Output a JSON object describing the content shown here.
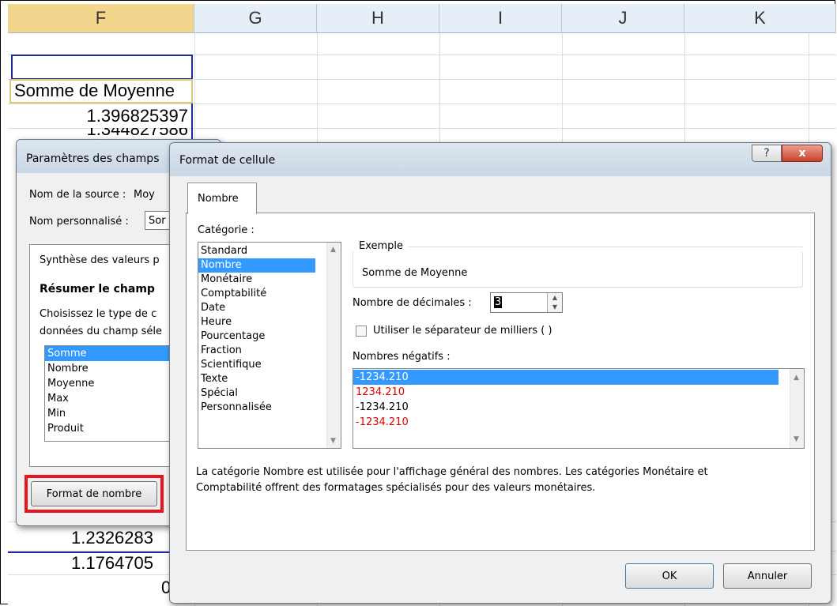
{
  "sheet": {
    "columns": [
      "F",
      "G",
      "H",
      "I",
      "J",
      "K"
    ],
    "cells": [
      "Somme de Moyenne",
      "1.396825397",
      "1.344827586",
      "1.2326283",
      "1.1764705",
      "0"
    ]
  },
  "field_dialog": {
    "title": "Paramètres des champs",
    "source_label": "Nom de la source :",
    "source_value": "Moy",
    "custom_label": "Nom personnalisé :",
    "custom_value": "Sor",
    "tab_label": "Synthèse des valeurs p",
    "section_title": "Résumer le champ",
    "desc_line1": "Choisissez le type de c",
    "desc_line2": "données du champ séle",
    "functions": [
      "Somme",
      "Nombre",
      "Moyenne",
      "Max",
      "Min",
      "Produit"
    ],
    "number_format_button": "Format de nombre"
  },
  "format_dialog": {
    "title": "Format de cellule",
    "help_icon": "question-icon",
    "close_icon": "close-icon",
    "tab": "Nombre",
    "category_label": "Catégorie :",
    "categories": [
      "Standard",
      "Nombre",
      "Monétaire",
      "Comptabilité",
      "Date",
      "Heure",
      "Pourcentage",
      "Fraction",
      "Scientifique",
      "Texte",
      "Spécial",
      "Personnalisée"
    ],
    "example_label": "Exemple",
    "example_value": "Somme de Moyenne",
    "decimals_label": "Nombre de décimales :",
    "decimals_value": "3",
    "thousands_label": "Utiliser le séparateur de milliers ( )",
    "negatives_label": "Nombres négatifs :",
    "negatives": [
      "-1234.210",
      "1234.210",
      "-1234.210",
      "-1234.210"
    ],
    "description_line1": "La catégorie Nombre est utilisée pour l'affichage général des nombres. Les catégories Monétaire et",
    "description_line2": "Comptabilité offrent des formatages spécialisés pour des valeurs monétaires.",
    "ok": "OK",
    "cancel": "Annuler"
  },
  "colors": {
    "selection": "#3399ff",
    "negative_red": "#e00000",
    "highlight_red": "#e8141e",
    "range_blue": "#1e2b9c"
  }
}
